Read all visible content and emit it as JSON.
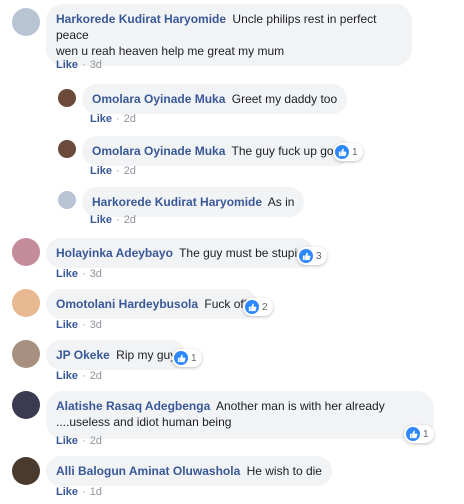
{
  "comments": [
    {
      "author": "Harkorede Kudirat Haryomide",
      "text": "Uncle philips rest in perfect peace",
      "text2": "wen u reah heaven help me great my mum",
      "like": "Like",
      "time": "3d"
    },
    {
      "author": "Omolara Oyinade Muka",
      "text": "Greet my daddy too",
      "like": "Like",
      "time": "2d"
    },
    {
      "author": "Omolara Oyinade Muka",
      "text": "The guy fuck up gon",
      "like": "Like",
      "time": "2d",
      "reactions": "1"
    },
    {
      "author": "Harkorede Kudirat Haryomide",
      "text": "As in",
      "like": "Like",
      "time": "2d"
    },
    {
      "author": "Holayinka Adeybayo",
      "text": "The guy must be stupid",
      "like": "Like",
      "time": "3d",
      "reactions": "3"
    },
    {
      "author": "Omotolani Hardeybusola",
      "text": "Fuck off",
      "like": "Like",
      "time": "3d",
      "reactions": "2"
    },
    {
      "author": "JP Okeke",
      "text": "Rip my guy",
      "like": "Like",
      "time": "2d",
      "reactions": "1"
    },
    {
      "author": "Alatishe Rasaq Adegbenga",
      "text": "Another man is with her already",
      "text2": "....useless and idiot human being",
      "like": "Like",
      "time": "2d",
      "reactions": "1"
    },
    {
      "author": "Alli Balogun Aminat Oluwashola",
      "text": "He wish to die",
      "like": "Like",
      "time": "1d"
    }
  ],
  "separator": "·",
  "colors": {
    "link": "#385898",
    "bubble": "#f2f3f5",
    "meta": "#90949c",
    "like_badge": "#2d88ff"
  },
  "icons": {
    "reaction": "thumbs-up-icon"
  }
}
